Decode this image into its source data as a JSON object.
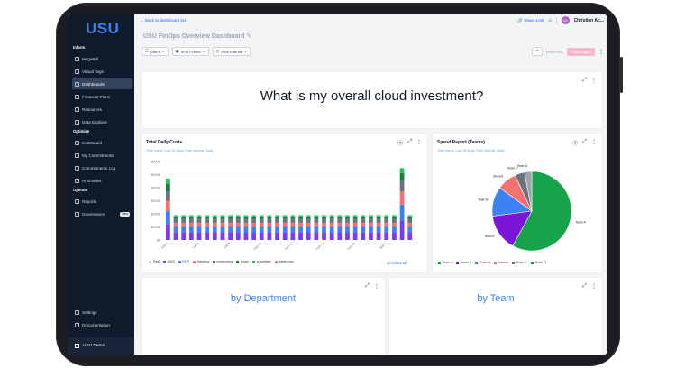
{
  "sidebar": {
    "logo": "USU",
    "sections": {
      "inform": "Inform",
      "optimize": "Optimize",
      "operate": "Operate"
    },
    "items": [
      {
        "label": "MegaBill"
      },
      {
        "label": "Virtual Tags"
      },
      {
        "label": "Dashboards"
      },
      {
        "label": "Financial Plans"
      },
      {
        "label": "Resources"
      },
      {
        "label": "Data Explorer"
      },
      {
        "label": "CostGuard"
      },
      {
        "label": "My Commitments"
      },
      {
        "label": "Commitments Log"
      },
      {
        "label": "Anomalies"
      },
      {
        "label": "Reports"
      },
      {
        "label": "Governance",
        "badge": "New"
      },
      {
        "label": "Settings"
      },
      {
        "label": "Documentation"
      }
    ],
    "user": "USU Demo"
  },
  "topbar": {
    "back": "Back to dashboard list",
    "share": "Share Link",
    "avatar_initials": "CA",
    "user_name": "Christian Ac..."
  },
  "dashboard": {
    "title": "USU FinOps Overview Dashboard",
    "filters": "Filters",
    "time_frame": "Time Frame",
    "time_interval": "Time Interval",
    "subscribe": "Subscribe",
    "add_widget": "Add widget"
  },
  "widgets": {
    "question": "What is my overall cloud investment?",
    "by_department": "by Department",
    "by_team": "by Team",
    "daily": {
      "title": "Total Daily Costs",
      "subtitle": "Time frame: Last 30 Days   Time Interval: Daily",
      "unselect": "Unselect all",
      "legend": [
        {
          "name": "Total",
          "color": "#d1d5db"
        },
        {
          "name": "AWS",
          "color": "#7c3aed"
        },
        {
          "name": "GCP",
          "color": "#3b82f6"
        },
        {
          "name": "Datadog",
          "color": "#f87171"
        },
        {
          "name": "kubernetes",
          "color": "#6b7280"
        },
        {
          "name": "Azure",
          "color": "#15803d"
        },
        {
          "name": "snowflake",
          "color": "#22c55e"
        },
        {
          "name": "databricks",
          "color": "#f472b6"
        }
      ]
    },
    "spend": {
      "title": "Spend Report (Teams)",
      "subtitle": "Time frame: Last 30 Days   Time Interval: Daily",
      "legend": [
        {
          "name": "Team A",
          "color": "#16a34a"
        },
        {
          "name": "Team E",
          "color": "#7c16d6"
        },
        {
          "name": "Team B",
          "color": "#3b82f6"
        },
        {
          "name": "Shared",
          "color": "#f87171"
        },
        {
          "name": "Team C",
          "color": "#6b7280"
        },
        {
          "name": "Team D",
          "color": "#16a34a"
        }
      ]
    }
  },
  "chart_data": [
    {
      "type": "bar",
      "title": "Total Daily Costs",
      "y_ticks": [
        "$600K",
        "$500K",
        "$400K",
        "$300K",
        "$200K",
        "$100K",
        "$0"
      ],
      "ylim": [
        0,
        600000
      ],
      "x_tick_labels": [
        "Feb 1",
        "Feb 5",
        "Feb 9",
        "Feb 13",
        "Feb 17",
        "Feb 21",
        "Feb 25",
        "Mar 1"
      ],
      "bar_count": 32,
      "series": [
        {
          "name": "AWS",
          "values": [
            120000,
            60000,
            60000,
            60000,
            60000,
            60000,
            60000,
            60000,
            60000,
            60000,
            60000,
            60000,
            60000,
            60000,
            60000,
            60000,
            60000,
            60000,
            60000,
            60000,
            60000,
            60000,
            60000,
            60000,
            60000,
            60000,
            60000,
            60000,
            60000,
            60000,
            150000,
            60000
          ]
        },
        {
          "name": "GCP",
          "values": [
            100000,
            40000,
            40000,
            40000,
            40000,
            40000,
            40000,
            40000,
            40000,
            40000,
            40000,
            40000,
            40000,
            40000,
            40000,
            40000,
            40000,
            40000,
            40000,
            40000,
            40000,
            40000,
            40000,
            40000,
            40000,
            40000,
            40000,
            40000,
            40000,
            40000,
            120000,
            40000
          ]
        },
        {
          "name": "Datadog",
          "values": [
            80000,
            30000,
            30000,
            30000,
            30000,
            30000,
            30000,
            30000,
            30000,
            30000,
            30000,
            30000,
            30000,
            30000,
            30000,
            30000,
            30000,
            30000,
            30000,
            30000,
            30000,
            30000,
            30000,
            30000,
            30000,
            30000,
            30000,
            30000,
            30000,
            30000,
            100000,
            30000
          ]
        },
        {
          "name": "kubernetes",
          "values": [
            70000,
            30000,
            30000,
            30000,
            30000,
            30000,
            30000,
            30000,
            30000,
            30000,
            30000,
            30000,
            30000,
            30000,
            30000,
            30000,
            30000,
            30000,
            30000,
            30000,
            30000,
            30000,
            30000,
            30000,
            30000,
            30000,
            30000,
            30000,
            30000,
            30000,
            80000,
            30000
          ]
        },
        {
          "name": "Azure",
          "values": [
            60000,
            20000,
            20000,
            20000,
            20000,
            20000,
            20000,
            20000,
            20000,
            20000,
            20000,
            20000,
            20000,
            20000,
            20000,
            20000,
            20000,
            20000,
            20000,
            20000,
            20000,
            20000,
            20000,
            20000,
            20000,
            20000,
            20000,
            20000,
            20000,
            20000,
            60000,
            20000
          ]
        },
        {
          "name": "snowflake",
          "values": [
            40000,
            10000,
            10000,
            10000,
            10000,
            10000,
            10000,
            10000,
            10000,
            10000,
            10000,
            10000,
            10000,
            10000,
            10000,
            10000,
            10000,
            10000,
            10000,
            10000,
            10000,
            10000,
            10000,
            10000,
            10000,
            10000,
            10000,
            10000,
            10000,
            10000,
            40000,
            10000
          ]
        }
      ]
    },
    {
      "type": "pie",
      "title": "Spend Report (Teams)",
      "categories": [
        "Team A",
        "Team E",
        "Team B",
        "Shared",
        "Team C",
        "Team D"
      ],
      "values": [
        58,
        15,
        12,
        8,
        4,
        3
      ]
    }
  ]
}
